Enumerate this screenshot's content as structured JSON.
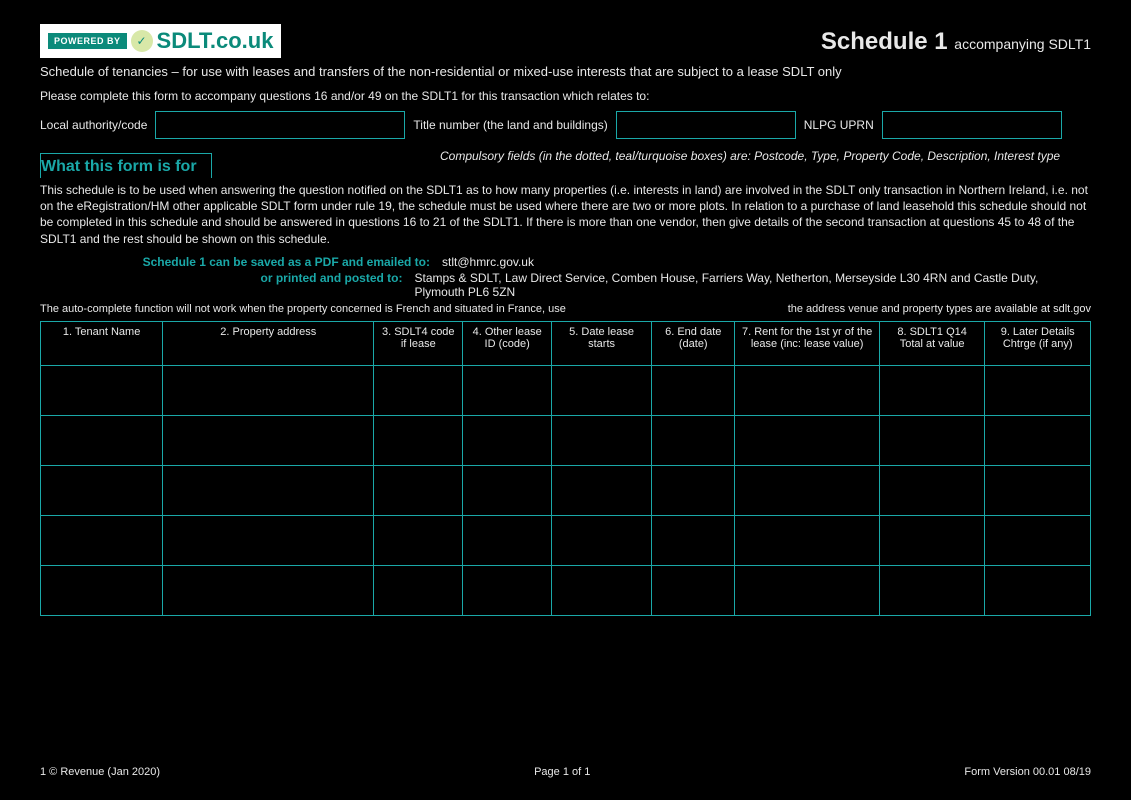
{
  "logo": {
    "powered": "POWERED BY",
    "brand": "SDLT.co.uk"
  },
  "header": {
    "big": "Schedule 1 ",
    "small": "accompanying SDLT1"
  },
  "line1": "Schedule of tenancies – for use with leases and transfers of the non-residential or mixed-use interests that are subject to a lease SDLT only",
  "line2": "Please complete this form to accompany questions 16 and/or 49 on the SDLT1 for this transaction which relates to:",
  "inputs": {
    "local_auth_label": "Local authority/code",
    "title_label": "Title number (the land and buildings)",
    "nlpg_label": "NLPG UPRN"
  },
  "section_head": "What this form is for",
  "compulsory": "Compulsory fields (in the dotted, teal/turquoise boxes) are: Postcode, Type, Property Code, Description, Interest type",
  "body_text": "This schedule is to be used when answering the question notified on the SDLT1 as to how many properties (i.e. interests in land) are involved in the SDLT only transaction in Northern Ireland, i.e. not on the eRegistration/HM other applicable SDLT form under rule 19, the schedule must be used where there are two or more plots. In relation to a purchase of land leasehold this schedule should not be completed in this schedule and should be answered in questions 16 to 21 of the SDLT1. If there is more than one vendor, then give details of the second transaction at questions 45 to 48 of the SDLT1 and the rest should be shown on this schedule.",
  "submit": {
    "save_label": "Schedule 1 can be saved as a PDF and emailed to:",
    "save_value": "stlt@hmrc.gov.uk",
    "post_label": "or printed and posted to:",
    "post_value": "Stamps & SDLT, Law Direct Service, Comben House, Farriers Way, Netherton, Merseyside L30 4RN and Castle Duty, Plymouth PL6 5ZN"
  },
  "autocomplete": {
    "left": "The auto-complete function will not work when the property concerned is French and situated in France, use",
    "right": "the address venue and property types are available at sdlt.gov"
  },
  "columns": [
    "1. Tenant Name",
    "2. Property address",
    "3. SDLT4 code if lease",
    "4. Other lease ID (code)",
    "5. Date lease starts",
    "6. End date (date)",
    "7. Rent for the 1st yr of the lease (inc: lease value)",
    "8. SDLT1 Q14 Total at value",
    "9. Later Details Chtrge (if any)"
  ],
  "rows": [
    [
      "",
      "",
      "",
      "",
      "",
      "",
      "",
      "",
      ""
    ],
    [
      "",
      "",
      "",
      "",
      "",
      "",
      "",
      "",
      ""
    ],
    [
      "",
      "",
      "",
      "",
      "",
      "",
      "",
      "",
      ""
    ],
    [
      "",
      "",
      "",
      "",
      "",
      "",
      "",
      "",
      ""
    ],
    [
      "",
      "",
      "",
      "",
      "",
      "",
      "",
      "",
      ""
    ]
  ],
  "footer": {
    "left": "1    © Revenue (Jan 2020)",
    "center": "Page 1 of 1",
    "right": "Form Version 00.01    08/19"
  }
}
